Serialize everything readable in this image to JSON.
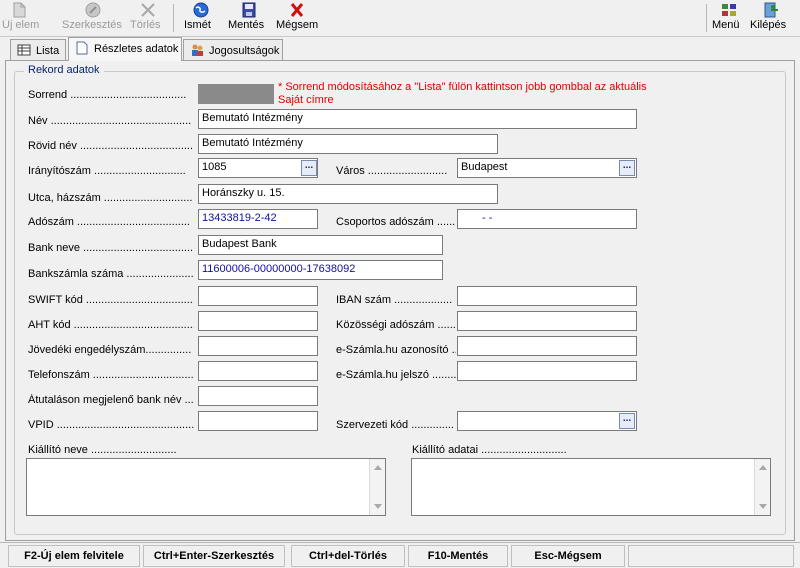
{
  "toolbar": {
    "new_label": "Új elem",
    "edit_label": "Szerkesztés",
    "delete_label": "Törlés",
    "refresh_label": "Ismét",
    "save_label": "Mentés",
    "cancel_label": "Mégsem",
    "menu_label": "Menü",
    "exit_label": "Kilépés"
  },
  "tabs": [
    {
      "label": "Lista"
    },
    {
      "label": "Részletes adatok"
    },
    {
      "label": "Jogosultságok"
    }
  ],
  "form": {
    "group_title": "Rekord adatok",
    "order_note_line1": "* Sorrend módosításához a \"Lista\" fülön kattintson jobb gombbal az aktuális",
    "order_note_line2": "Saját címre",
    "labels": {
      "sorrend": "Sorrend ......................................",
      "nev": "Név ..............................................",
      "rovid_nev": "Rövid név ......................................",
      "iranyitoszam": "Irányítószám ..............................",
      "varos": "Város ..........................",
      "utca": "Utca, házszám .............................",
      "adoszam": "Adószám .....................................",
      "csoportos_adoszam": "Csoportos adószám .......",
      "bank_neve": "Bank neve .....................................",
      "bankszamla": "Bankszámla száma ......................",
      "swift": "SWIFT kód ......................................",
      "iban": "IBAN szám ...................",
      "aht": "AHT kód ...........................................",
      "kozossegi": "Közösségi adószám .........",
      "jovedeki": "Jövedéki engedélyszám...............",
      "eszamla_azon": "e-Számla.hu azonosító ....",
      "telefon": "Telefonszám ...................................",
      "eszamla_jelszo": "e-Számla.hu jelszó ..........",
      "atutalason": "Átutaláson megjelenő bank név ....",
      "vpid": "VPID .................................................",
      "szervezeti": "Szervezeti kód ..............",
      "kiallito_neve": "Kiállító neve ............................",
      "kiallito_adatai": "Kiállító adatai ............................"
    },
    "values": {
      "nev": "Bemutató Intézmény",
      "rovid_nev": "Bemutató Intézmény",
      "iranyitoszam": "1085",
      "varos": "Budapest",
      "utca": "Horánszky u. 15.",
      "adoszam": "13433819-2-42",
      "csoportos_adoszam": "- -",
      "bank_neve": "Budapest Bank",
      "bankszamla": "11600006-00000000-17638092",
      "swift": "",
      "iban": "",
      "aht": "",
      "kozossegi": "",
      "jovedeki": "",
      "eszamla_azon": "",
      "telefon": "",
      "eszamla_jelszo": "",
      "atutalason": "",
      "vpid": "",
      "szervezeti": ""
    },
    "lookup_glyph": "..."
  },
  "statusbar": [
    {
      "label": "F2-Új elem felvitele"
    },
    {
      "label": "Ctrl+Enter-Szerkesztés"
    },
    {
      "label": "Ctrl+del-Törlés"
    },
    {
      "label": "F10-Mentés"
    },
    {
      "label": "Esc-Mégsem"
    }
  ]
}
